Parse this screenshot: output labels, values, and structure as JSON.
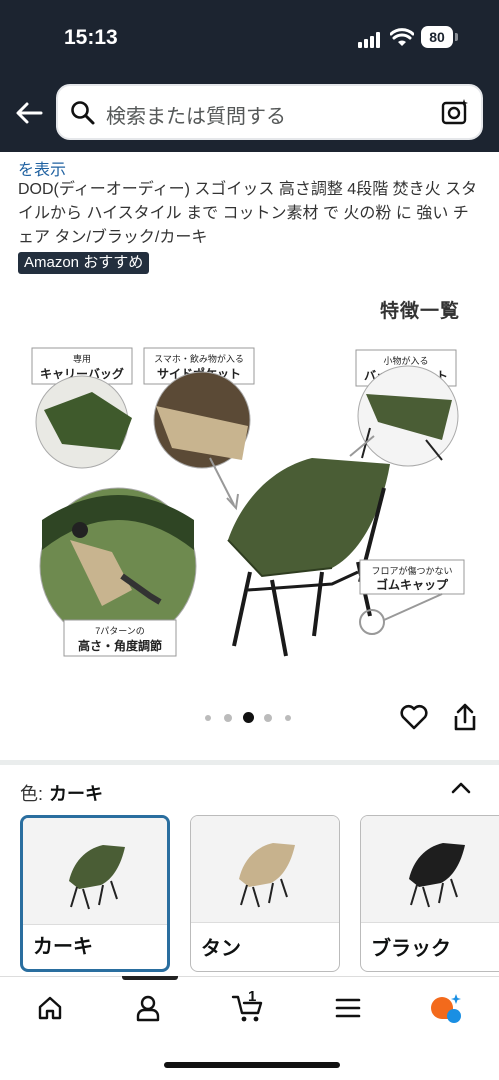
{
  "status_bar": {
    "time": "15:13",
    "battery": "80"
  },
  "search": {
    "placeholder": "検索または質問する"
  },
  "product": {
    "show_link": "を表示",
    "title": "DOD(ディーオーディー) スゴイッス 高さ調整 4段階 焚き火 スタイルから ハイスタイル まで コットン素材 で 火の粉 に 強い チェア タン/ブラック/カーキ",
    "badge": "Amazon おすすめ"
  },
  "image": {
    "features_label": "特徴一覧",
    "callouts": {
      "carry_bag_small": "専用",
      "carry_bag": "キャリーバッグ",
      "side_pocket_small": "スマホ・飲み物が入る",
      "side_pocket": "サイドポケット",
      "back_pocket_small": "小物が入る",
      "back_pocket": "バックポケット",
      "rubber_cap_small": "フロアが傷つかない",
      "rubber_cap": "ゴムキャップ",
      "adjust_small": "7パターンの",
      "adjust": "高さ・角度調節"
    },
    "carousel": {
      "count": 5,
      "active_index": 2
    }
  },
  "color_selector": {
    "label": "色:",
    "selected": "カーキ",
    "options": [
      {
        "name": "カーキ",
        "color": "#4a5d35",
        "selected": true
      },
      {
        "name": "タン",
        "color": "#c7b28d",
        "selected": false
      },
      {
        "name": "ブラック",
        "color": "#1e1e1e",
        "selected": false
      }
    ]
  },
  "bottom_nav": {
    "cart_count": "1",
    "items": [
      "home-icon",
      "account-icon",
      "cart-icon",
      "menu-icon",
      "rufus-icon"
    ]
  }
}
